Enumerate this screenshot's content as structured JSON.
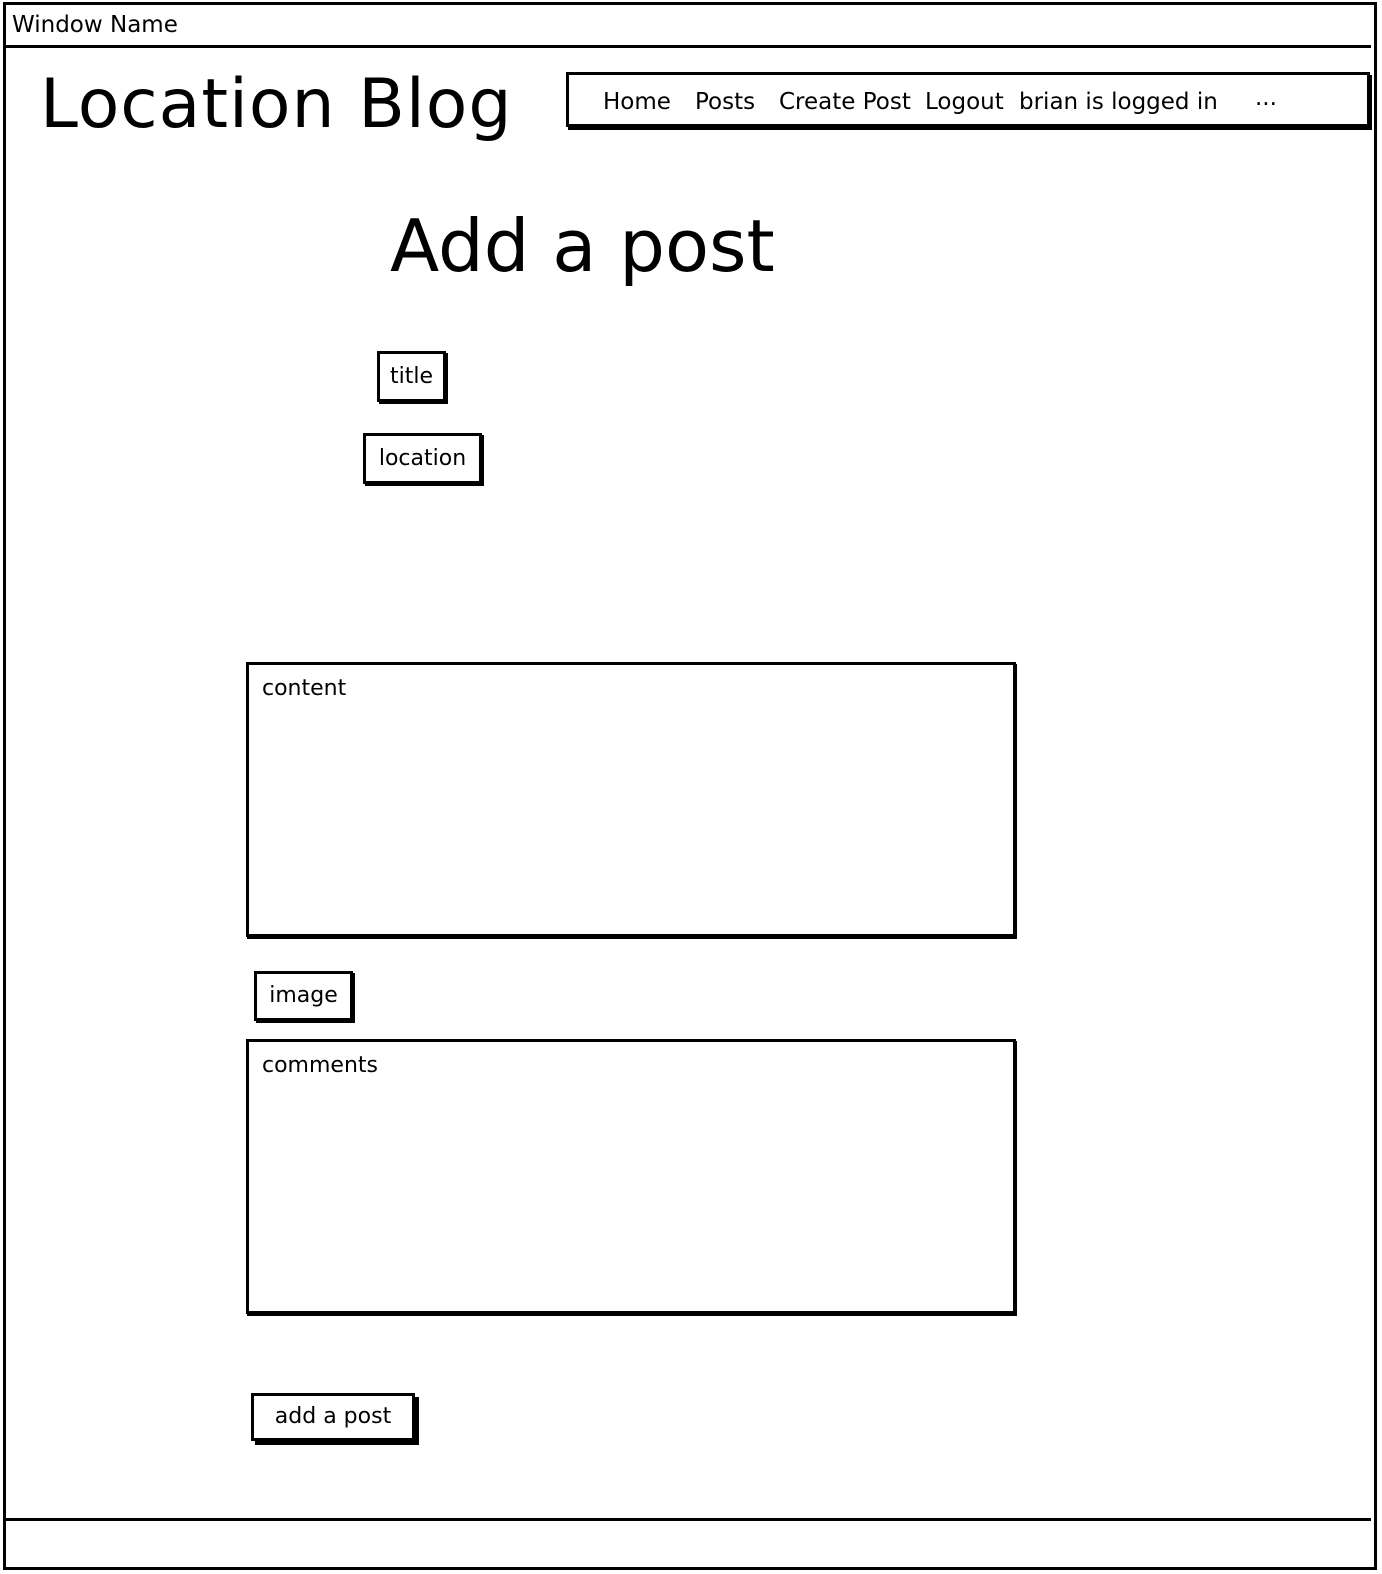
{
  "window": {
    "title": "Window Name"
  },
  "app": {
    "title": "Location Blog"
  },
  "nav": {
    "items": [
      {
        "label": "Home"
      },
      {
        "label": "Posts"
      },
      {
        "label": "Create Post"
      },
      {
        "label": "Logout"
      }
    ],
    "user_status": "brian is logged in",
    "overflow_label": "..."
  },
  "page": {
    "heading": "Add a post"
  },
  "form": {
    "title_field": "title",
    "location_field": "location",
    "content_field": "content",
    "image_field": "image",
    "comments_field": "comments",
    "submit_label": "add a post"
  }
}
